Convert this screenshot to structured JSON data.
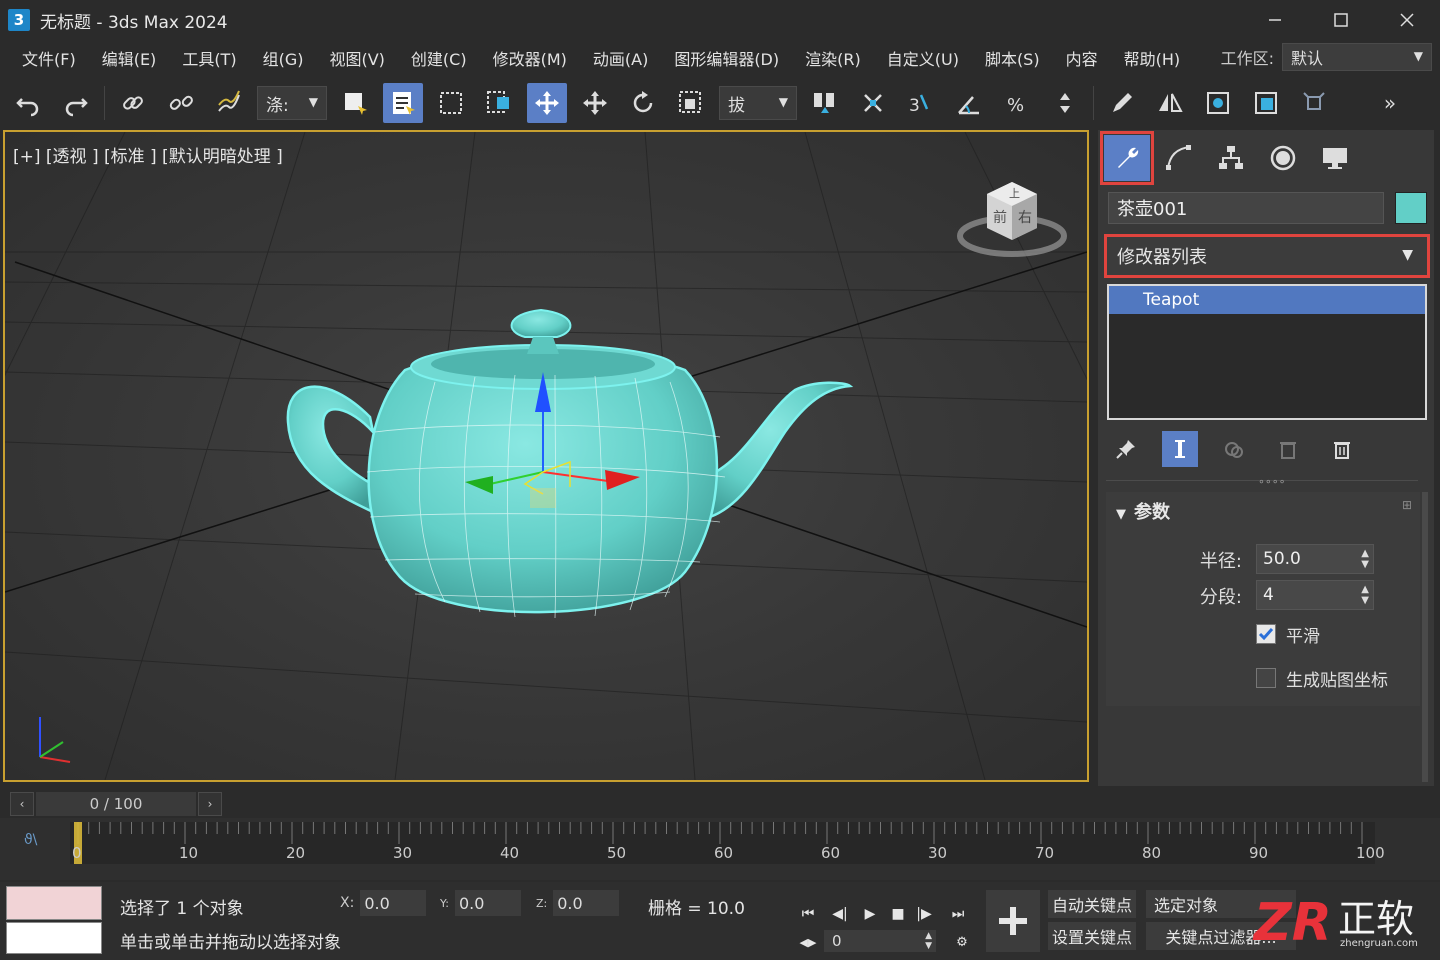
{
  "window": {
    "title": "无标题 - 3ds Max 2024",
    "app_badge": "3"
  },
  "menu": [
    "文件(F)",
    "编辑(E)",
    "工具(T)",
    "组(G)",
    "视图(V)",
    "创建(C)",
    "修改器(M)",
    "动画(A)",
    "图形编辑器(D)",
    "渲染(R)",
    "自定义(U)",
    "脚本(S)",
    "内容",
    "帮助(H)"
  ],
  "workspace": {
    "label": "工作区:",
    "value": "默认"
  },
  "toolbar": {
    "selection_filter": "涤:",
    "ref_coord": "拔",
    "overflow": "»"
  },
  "viewport": {
    "label": "[+] [透视 ] [标准 ] [默认明暗处理 ]",
    "viewcube": {
      "top": "上",
      "front": "前",
      "right": "右"
    },
    "colors": {
      "teapot": "#62cfc7",
      "highlight": "#7df2ee",
      "active_border": "#c8a030"
    }
  },
  "command_panel": {
    "object_name": "茶壶001",
    "object_color": "#62cfc7",
    "modifier_list": "修改器列表",
    "stack": [
      "Teapot"
    ],
    "handle": "∘∘∘∘",
    "params": {
      "title": "参数",
      "radius_label": "半径:",
      "radius_value": "50.0",
      "segments_label": "分段:",
      "segments_value": "4",
      "smooth_label": "平滑",
      "smooth_checked": true,
      "mapping_label": "生成贴图坐标",
      "mapping_checked": false
    }
  },
  "timeline": {
    "frame_display": "0 / 100",
    "ticks": [
      "0",
      "10",
      "20",
      "30",
      "40",
      "50",
      "60",
      "60",
      "30",
      "70",
      "80",
      "90",
      "100"
    ]
  },
  "status": {
    "selected": "选择了 1 个对象",
    "hint": "单击或单击并拖动以选择对象",
    "x_label": "X:",
    "x_value": "0.0",
    "y_label": "Y:",
    "y_value": "0.0",
    "z_label": "Z:",
    "z_value": "0.0",
    "grid": "栅格 = 10.0",
    "frame": "0",
    "auto_key": "自动关键点",
    "set_key": "设置关键点",
    "selected_obj": "选定对象",
    "key_filters": "关键点过滤器..."
  },
  "watermark": {
    "brand": "ZR",
    "name": "正软",
    "site": "zhengruan.com"
  }
}
